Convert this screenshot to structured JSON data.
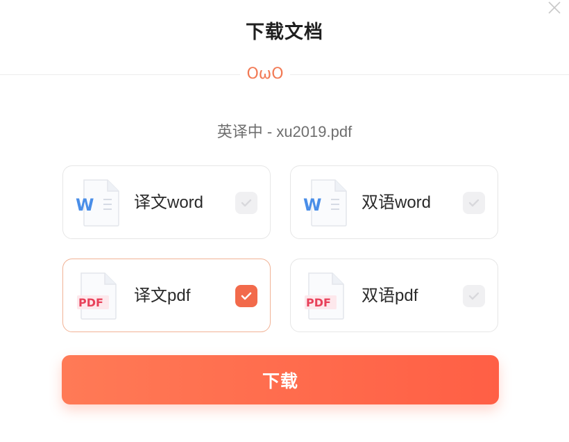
{
  "dialog": {
    "title": "下载文档",
    "mascot": "OωO",
    "file_info": "英译中 - xu2019.pdf"
  },
  "options": [
    {
      "label": "译文word",
      "icon": "word-doc-icon",
      "checked": false
    },
    {
      "label": "双语word",
      "icon": "word-doc-icon",
      "checked": false
    },
    {
      "label": "译文pdf",
      "icon": "pdf-doc-icon",
      "checked": true
    },
    {
      "label": "双语pdf",
      "icon": "pdf-doc-icon",
      "checked": false
    }
  ],
  "icons": {
    "word_letter": "W",
    "pdf_text": "PDF"
  },
  "colors": {
    "accent": "#ff6a4d",
    "word_blue": "#4a8ee8",
    "pdf_red": "#e8415a",
    "selected_border": "#f1b295"
  },
  "download_button": {
    "label": "下载"
  }
}
